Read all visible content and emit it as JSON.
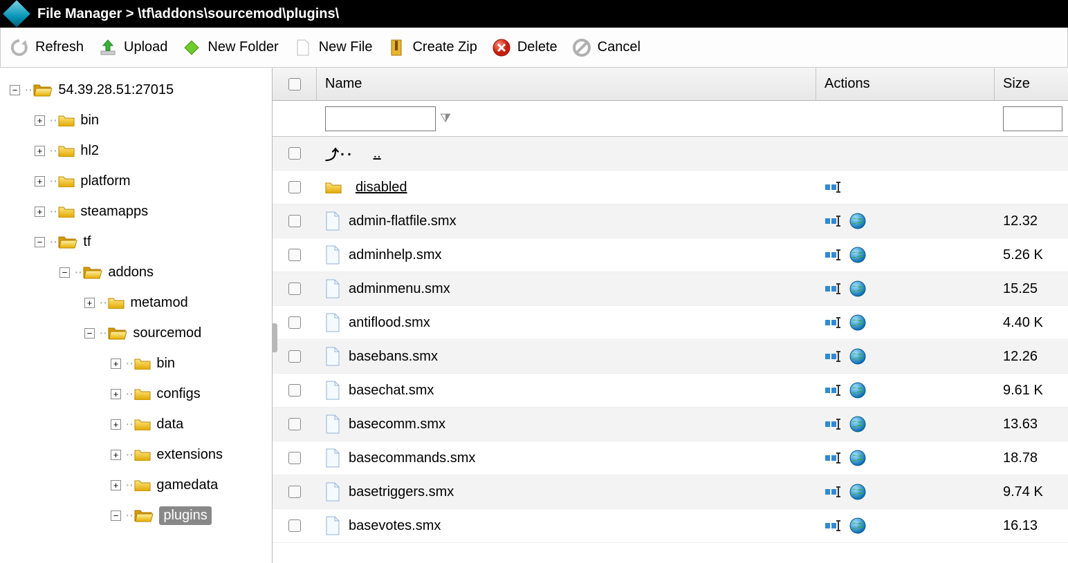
{
  "header": {
    "title_prefix": "File Manager >",
    "path": "\\tf\\addons\\sourcemod\\plugins\\"
  },
  "toolbar": {
    "refresh": "Refresh",
    "upload": "Upload",
    "new_folder": "New Folder",
    "new_file": "New File",
    "create_zip": "Create Zip",
    "delete": "Delete",
    "cancel": "Cancel"
  },
  "tree": {
    "root": "54.39.28.51:27015",
    "nodes": [
      "bin",
      "hl2",
      "platform",
      "steamapps",
      "tf"
    ],
    "tf_child": "addons",
    "addons_children": [
      "metamod",
      "sourcemod"
    ],
    "sourcemod_children": [
      "bin",
      "configs",
      "data",
      "extensions",
      "gamedata",
      "plugins"
    ]
  },
  "columns": {
    "name": "Name",
    "actions": "Actions",
    "size": "Size"
  },
  "up_dir": "..",
  "files": [
    {
      "name": "disabled",
      "type": "folder",
      "size": "",
      "edit": false
    },
    {
      "name": "admin-flatfile.smx",
      "type": "file",
      "size": "12.32",
      "edit": true
    },
    {
      "name": "adminhelp.smx",
      "type": "file",
      "size": "5.26 K",
      "edit": true
    },
    {
      "name": "adminmenu.smx",
      "type": "file",
      "size": "15.25",
      "edit": true
    },
    {
      "name": "antiflood.smx",
      "type": "file",
      "size": "4.40 K",
      "edit": true
    },
    {
      "name": "basebans.smx",
      "type": "file",
      "size": "12.26",
      "edit": true
    },
    {
      "name": "basechat.smx",
      "type": "file",
      "size": "9.61 K",
      "edit": true
    },
    {
      "name": "basecomm.smx",
      "type": "file",
      "size": "13.63",
      "edit": true
    },
    {
      "name": "basecommands.smx",
      "type": "file",
      "size": "18.78",
      "edit": true
    },
    {
      "name": "basetriggers.smx",
      "type": "file",
      "size": "9.74 K",
      "edit": true
    },
    {
      "name": "basevotes.smx",
      "type": "file",
      "size": "16.13",
      "edit": true
    }
  ]
}
